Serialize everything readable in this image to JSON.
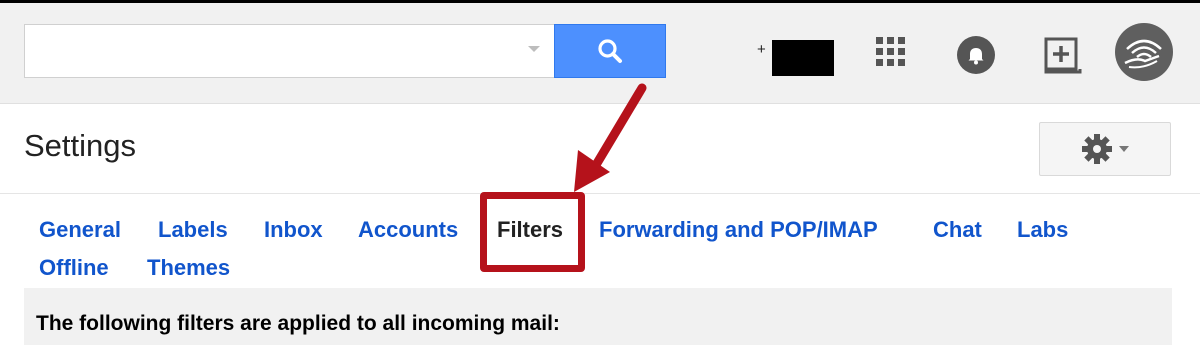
{
  "header": {
    "search": {
      "value": "",
      "placeholder": ""
    },
    "account_prefix": "+",
    "icons": {
      "search": "search-icon",
      "apps": "apps-grid-icon",
      "notifications": "notifications-bell-icon",
      "share": "share-add-icon",
      "avatar": "avatar-image"
    }
  },
  "settings": {
    "title": "Settings",
    "gear_icon": "gear-icon",
    "tabs": [
      {
        "label": "General"
      },
      {
        "label": "Labels"
      },
      {
        "label": "Inbox"
      },
      {
        "label": "Accounts"
      },
      {
        "label": "Filters",
        "active": true
      },
      {
        "label": "Forwarding and POP/IMAP"
      },
      {
        "label": "Chat"
      },
      {
        "label": "Labs"
      },
      {
        "label": "Offline"
      },
      {
        "label": "Themes"
      }
    ],
    "filters_intro": "The following filters are applied to all incoming mail:"
  },
  "colors": {
    "link": "#1155cc",
    "search_button": "#4d90fe",
    "annotation": "#b5121b",
    "header_bg": "#f1f1f1"
  }
}
